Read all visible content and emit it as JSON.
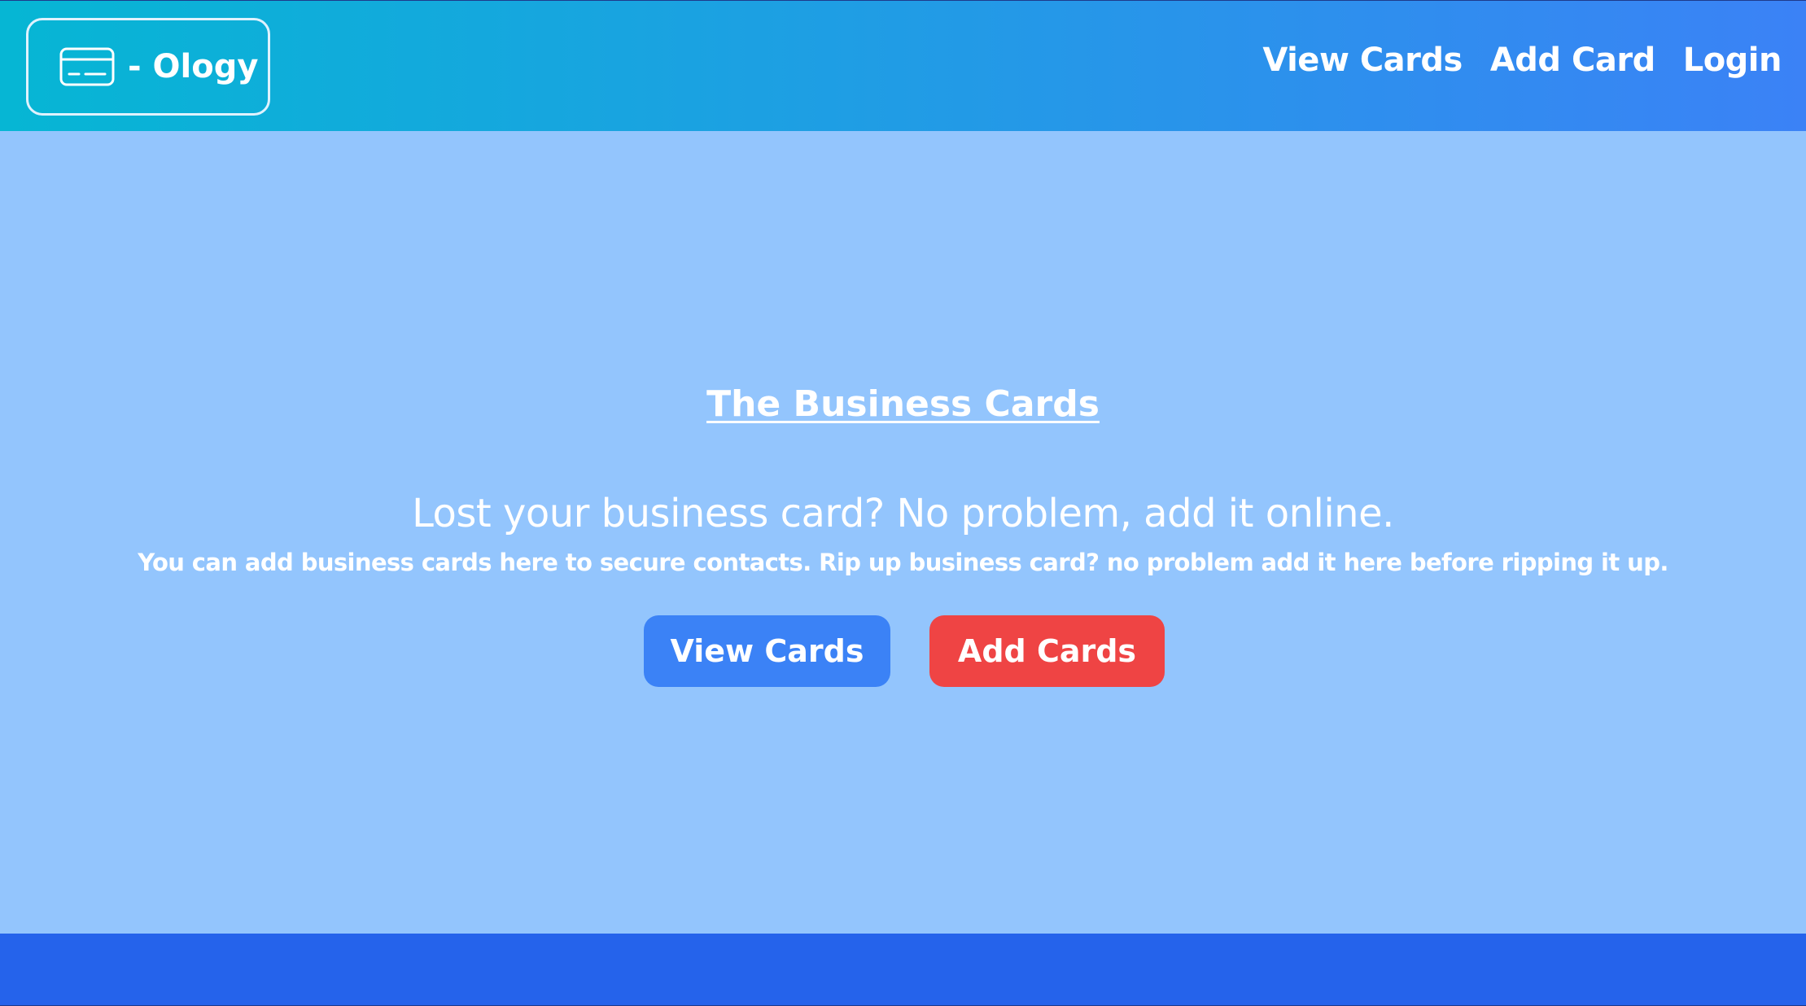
{
  "navbar": {
    "logo_text": "- Ology",
    "logo_icon": "credit-card-icon",
    "links": [
      {
        "label": "View Cards"
      },
      {
        "label": "Add Card"
      },
      {
        "label": "Login"
      }
    ]
  },
  "hero": {
    "title": "The Business Cards",
    "subtitle": "Lost your business card? No problem, add it online.",
    "description": "You can add business cards here to secure contacts. Rip up business card? no problem add it here before ripping it up.",
    "buttons": {
      "view_label": "View Cards",
      "add_label": "Add Cards"
    }
  },
  "colors": {
    "navbar_gradient_start": "#06b6d4",
    "navbar_gradient_end": "#3b82f6",
    "page_background": "#93c5fd",
    "view_button": "#3b82f6",
    "add_button": "#ef4444",
    "footer": "#2563eb"
  }
}
